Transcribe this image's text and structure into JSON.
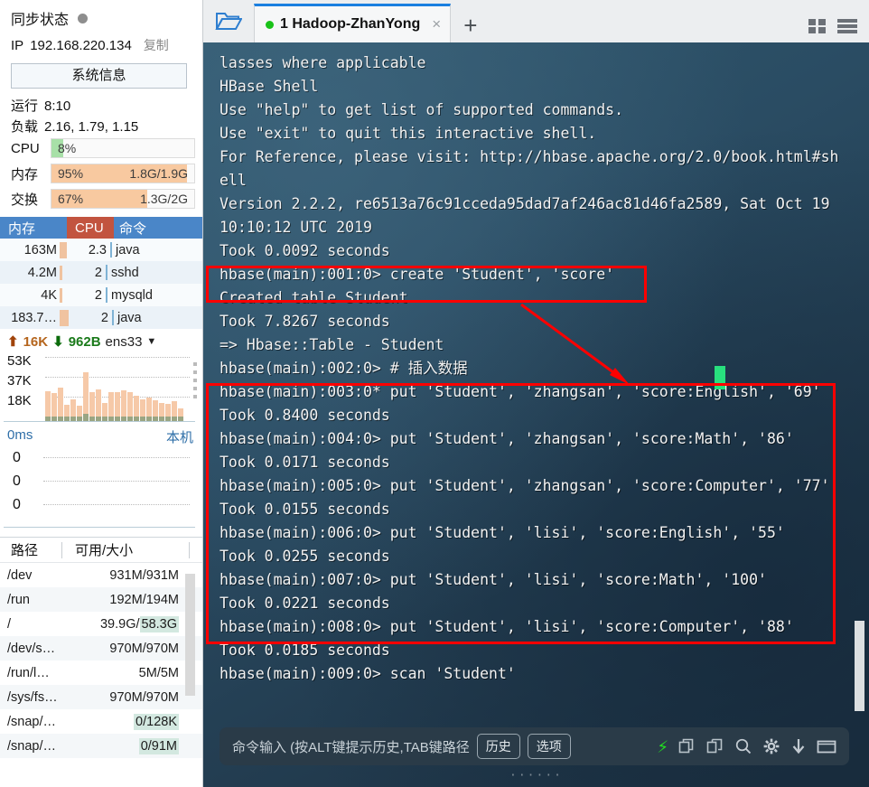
{
  "sidebar": {
    "sync": {
      "label": "同步状态",
      "status_icon": "filled-circle-icon"
    },
    "ip": {
      "key": "IP",
      "value": "192.168.220.134",
      "copy_label": "复制"
    },
    "sysinfo_button": "系统信息",
    "uptime": {
      "key": "运行",
      "value": "8:10"
    },
    "load": {
      "key": "负载",
      "value": "2.16, 1.79, 1.15"
    },
    "meters": [
      {
        "label": "CPU",
        "pct": "8%",
        "abs": "",
        "fill_pct": 8,
        "color": "#a8e0a8"
      },
      {
        "label": "内存",
        "pct": "95%",
        "abs": "1.8G/1.9G",
        "fill_pct": 95,
        "color": "#f8c9a0"
      },
      {
        "label": "交换",
        "pct": "67%",
        "abs": "1.3G/2G",
        "fill_pct": 67,
        "color": "#f8c9a0"
      }
    ],
    "process_table": {
      "headers": [
        "内存",
        "CPU",
        "命令"
      ],
      "active_header": "CPU",
      "rows": [
        {
          "mem": "163M",
          "cpu": "2.3",
          "cmd": "java",
          "membar": 10
        },
        {
          "mem": "4.2M",
          "cpu": "2",
          "cmd": "sshd",
          "membar": 3
        },
        {
          "mem": "4K",
          "cpu": "2",
          "cmd": "mysqld",
          "membar": 3
        },
        {
          "mem": "183.7…",
          "cpu": "2",
          "cmd": "java",
          "membar": 11
        }
      ]
    },
    "network": {
      "up": "16K",
      "down": "962B",
      "interface": "ens33",
      "y_labels": [
        "53K",
        "37K",
        "18K"
      ]
    },
    "ping": {
      "ms": "0ms",
      "host": "本机",
      "y_labels": [
        "0",
        "0",
        "0"
      ]
    },
    "disk_table": {
      "headers": [
        "路径",
        "可用/大小"
      ],
      "rows": [
        {
          "path": "/dev",
          "size": "931M/931M",
          "highlight": false
        },
        {
          "path": "/run",
          "size": "192M/194M",
          "highlight": false
        },
        {
          "path": "/",
          "size_prefix": "39.9G/",
          "size_hl": "58.3G",
          "size": "39.9G/58.3G",
          "highlight": true
        },
        {
          "path": "/dev/s…",
          "size": "970M/970M",
          "highlight": false
        },
        {
          "path": "/run/l…",
          "size": "5M/5M",
          "highlight": false
        },
        {
          "path": "/sys/fs…",
          "size": "970M/970M",
          "highlight": false
        },
        {
          "path": "/snap/…",
          "size": "0/128K",
          "highlight": true
        },
        {
          "path": "/snap/…",
          "size": "0/91M",
          "highlight": true
        }
      ]
    }
  },
  "tabbar": {
    "folder_icon": "open-folder-icon",
    "tab": {
      "title": "1 Hadoop-ZhanYong",
      "status_icon": "green-dot-icon",
      "close_label": "×"
    },
    "new_tab_label": "+",
    "grid_icon": "grid-view-icon",
    "list_icon": "list-view-icon"
  },
  "terminal": {
    "lines": [
      "lasses where applicable",
      "HBase Shell",
      "Use \"help\" to get list of supported commands.",
      "Use \"exit\" to quit this interactive shell.",
      "For Reference, please visit: http://hbase.apache.org/2.0/book.html#sh",
      "ell",
      "Version 2.2.2, re6513a76c91cceda95dad7af246ac81d46fa2589, Sat Oct 19",
      "10:10:12 UTC 2019",
      "Took 0.0092 seconds",
      "hbase(main):001:0> create 'Student', 'score'",
      "Created table Student",
      "Took 7.8267 seconds",
      "=> Hbase::Table - Student",
      "hbase(main):002:0> # 插入数据",
      "hbase(main):003:0* put 'Student', 'zhangsan', 'score:English', '69'",
      "Took 0.8400 seconds",
      "hbase(main):004:0> put 'Student', 'zhangsan', 'score:Math', '86'",
      "Took 0.0171 seconds",
      "hbase(main):005:0> put 'Student', 'zhangsan', 'score:Computer', '77'",
      "Took 0.0155 seconds",
      "hbase(main):006:0> put 'Student', 'lisi', 'score:English', '55'",
      "Took 0.0255 seconds",
      "hbase(main):007:0> put 'Student', 'lisi', 'score:Math', '100'",
      "Took 0.0221 seconds",
      "hbase(main):008:0> put 'Student', 'lisi', 'score:Computer', '88'",
      "Took 0.0185 seconds",
      "hbase(main):009:0> scan 'Student'"
    ],
    "annotation_color": "#ff0000",
    "cursor_color": "#28e07e"
  },
  "command_bar": {
    "placeholder": "命令输入 (按ALT键提示历史,TAB键路径",
    "history_chip": "历史",
    "options_chip": "选项",
    "icons": [
      "bolt-icon",
      "copy-icon",
      "paste-icon",
      "search-icon",
      "gear-icon",
      "download-icon",
      "window-icon"
    ]
  }
}
